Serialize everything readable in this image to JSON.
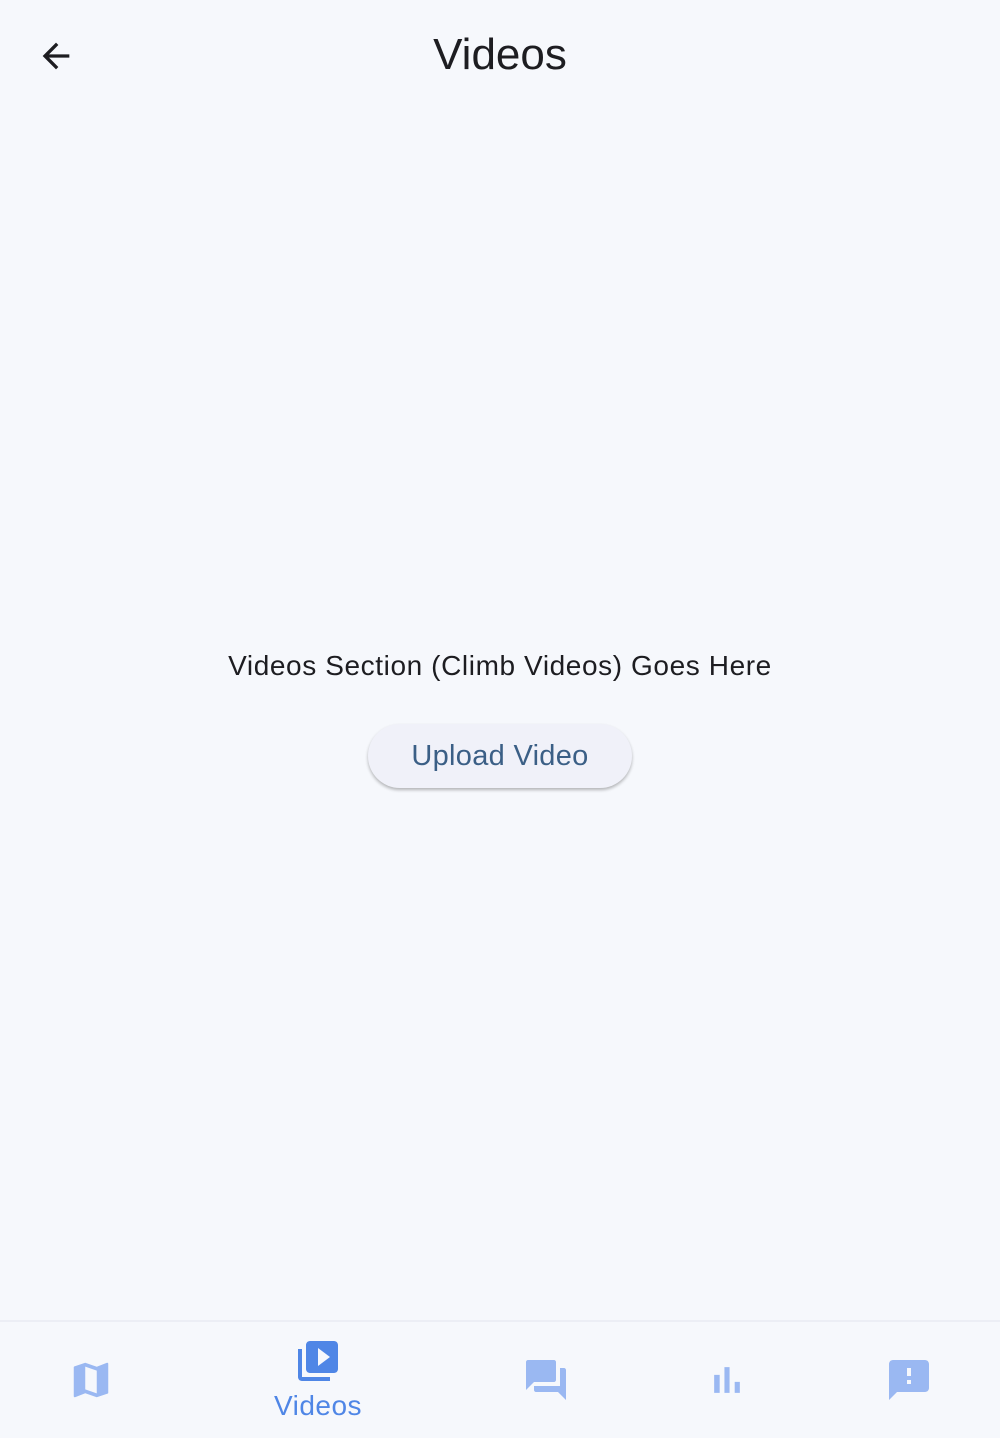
{
  "header": {
    "back_icon": "arrow-back-icon",
    "title": "Videos"
  },
  "main": {
    "placeholder_text": "Videos Section (Climb Videos) Goes Here",
    "upload_button_label": "Upload Video"
  },
  "bottom_nav": {
    "items": [
      {
        "icon": "map-icon",
        "label": "",
        "selected": false
      },
      {
        "icon": "video-library-icon",
        "label": "Videos",
        "selected": true
      },
      {
        "icon": "forum-icon",
        "label": "",
        "selected": false
      },
      {
        "icon": "bar-chart-icon",
        "label": "",
        "selected": false
      },
      {
        "icon": "feedback-icon",
        "label": "",
        "selected": false
      }
    ]
  },
  "colors": {
    "background": "#f6f8fc",
    "accent": "#4f86e6",
    "inactive_icon": "#9ab8f2",
    "button_text": "#3b5f86",
    "button_bg": "#f0f1f9",
    "text": "#1d1d21"
  }
}
